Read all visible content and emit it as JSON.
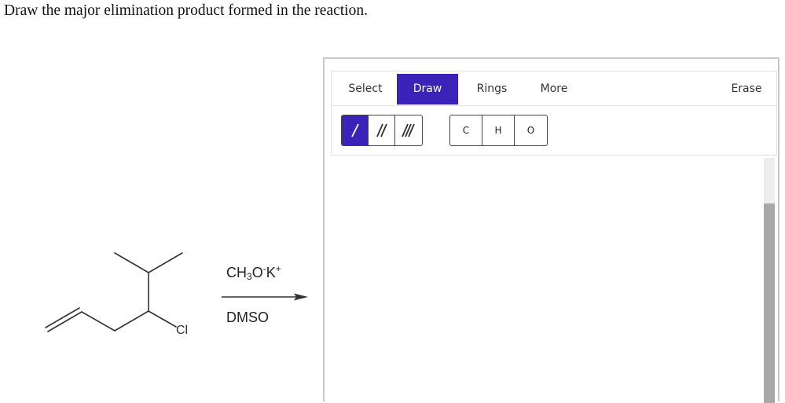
{
  "question": "Draw the major elimination product formed in the reaction.",
  "reaction": {
    "reagent_top": {
      "base": "CH",
      "sub": "3",
      "mid": "O",
      "sup1": "-",
      "cation": "K",
      "sup2": "+"
    },
    "reagent_bottom": "DMSO",
    "leaving_group_label": "Cl"
  },
  "editor": {
    "tabs": [
      {
        "label": "Select",
        "active": false
      },
      {
        "label": "Draw",
        "active": true
      },
      {
        "label": "Rings",
        "active": false
      },
      {
        "label": "More",
        "active": false
      },
      {
        "label": "Erase",
        "active": false
      }
    ],
    "bond_tools": [
      {
        "name": "single-bond",
        "active": true
      },
      {
        "name": "double-bond",
        "active": false
      },
      {
        "name": "triple-bond",
        "active": false
      }
    ],
    "atom_tools": [
      "C",
      "H",
      "O"
    ],
    "accent_color": "#3b22b8"
  }
}
